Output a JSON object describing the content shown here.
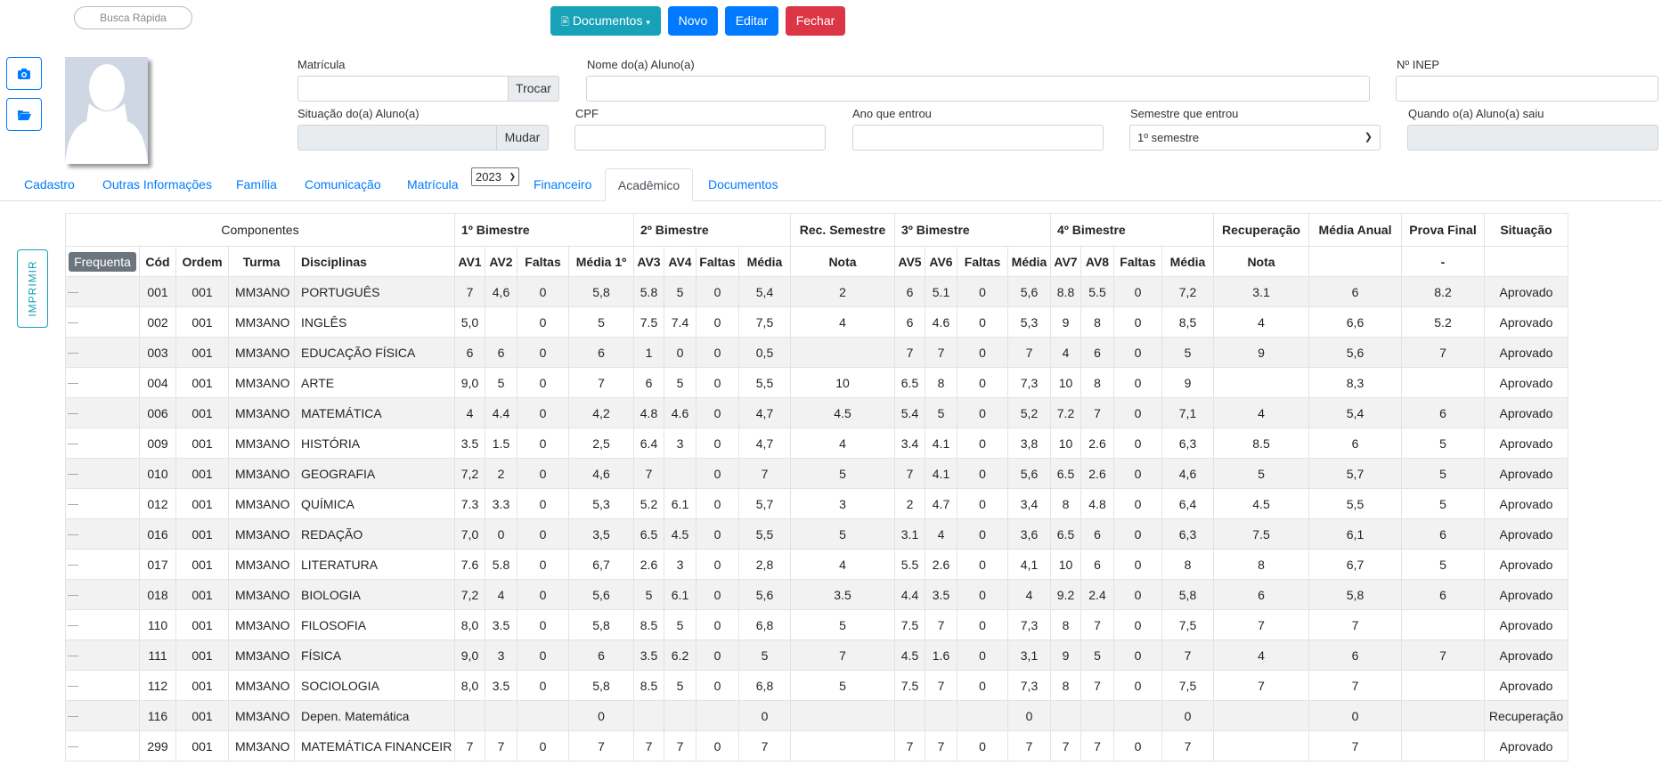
{
  "search": {
    "placeholder": "Busca Rápida"
  },
  "toolbar": {
    "documents": "Documentos",
    "new": "Novo",
    "edit": "Editar",
    "close": "Fechar"
  },
  "form": {
    "matricula_label": "Matrícula",
    "trocar": "Trocar",
    "nome_label": "Nome do(a) Aluno(a)",
    "inep_label": "Nº INEP",
    "situacao_label": "Situação do(a) Aluno(a)",
    "mudar": "Mudar",
    "cpf_label": "CPF",
    "ano_label": "Ano que entrou",
    "semestre_label": "Semestre que entrou",
    "semestre_value": "1º semestre",
    "saiu_label": "Quando o(a) Aluno(a) saiu"
  },
  "tabs": [
    "Cadastro",
    "Outras Informações",
    "Família",
    "Comunicação",
    "Matrícula",
    "Financeiro",
    "Acadêmico",
    "Documentos"
  ],
  "year_select": "2023",
  "print_button": "IMPRIMIR",
  "table": {
    "groups": [
      "Componentes",
      "1º Bimestre",
      "2º Bimestre",
      "Rec. Semestre",
      "3º Bimestre",
      "4º Bimestre",
      "Recuperação",
      "Média Anual",
      "Prova Final",
      "Situação"
    ],
    "frequenta": "Frequenta",
    "headers": [
      "Cód",
      "Ordem",
      "Turma",
      "Disciplinas",
      "AV1",
      "AV2",
      "Faltas",
      "Média 1º",
      "AV3",
      "AV4",
      "Faltas",
      "Média",
      "Nota",
      "AV5",
      "AV6",
      "Faltas",
      "Média",
      "AV7",
      "AV8",
      "Faltas",
      "Média",
      "Nota",
      "",
      "-",
      ""
    ],
    "rows": [
      [
        "001",
        "001",
        "MM3ANO",
        "PORTUGUÊS",
        "7",
        "4,6",
        "0",
        "5,8",
        "5.8",
        "5",
        "0",
        "5,4",
        "2",
        "6",
        "5.1",
        "0",
        "5,6",
        "8.8",
        "5.5",
        "0",
        "7,2",
        "3.1",
        "6",
        "8.2",
        "Aprovado"
      ],
      [
        "002",
        "001",
        "MM3ANO",
        "INGLÊS",
        "5,0",
        "",
        "0",
        "5",
        "7.5",
        "7.4",
        "0",
        "7,5",
        "4",
        "6",
        "4.6",
        "0",
        "5,3",
        "9",
        "8",
        "0",
        "8,5",
        "4",
        "6,6",
        "5.2",
        "Aprovado"
      ],
      [
        "003",
        "001",
        "MM3ANO",
        "EDUCAÇÃO FÍSICA",
        "6",
        "6",
        "0",
        "6",
        "1",
        "0",
        "0",
        "0,5",
        "",
        "7",
        "7",
        "0",
        "7",
        "4",
        "6",
        "0",
        "5",
        "9",
        "5,6",
        "7",
        "Aprovado"
      ],
      [
        "004",
        "001",
        "MM3ANO",
        "ARTE",
        "9,0",
        "5",
        "0",
        "7",
        "6",
        "5",
        "0",
        "5,5",
        "10",
        "6.5",
        "8",
        "0",
        "7,3",
        "10",
        "8",
        "0",
        "9",
        "",
        "8,3",
        "",
        "Aprovado"
      ],
      [
        "006",
        "001",
        "MM3ANO",
        "MATEMÁTICA",
        "4",
        "4.4",
        "0",
        "4,2",
        "4.8",
        "4.6",
        "0",
        "4,7",
        "4.5",
        "5.4",
        "5",
        "0",
        "5,2",
        "7.2",
        "7",
        "0",
        "7,1",
        "4",
        "5,4",
        "6",
        "Aprovado"
      ],
      [
        "009",
        "001",
        "MM3ANO",
        "HISTÓRIA",
        "3.5",
        "1.5",
        "0",
        "2,5",
        "6.4",
        "3",
        "0",
        "4,7",
        "4",
        "3.4",
        "4.1",
        "0",
        "3,8",
        "10",
        "2.6",
        "0",
        "6,3",
        "8.5",
        "6",
        "5",
        "Aprovado"
      ],
      [
        "010",
        "001",
        "MM3ANO",
        "GEOGRAFIA",
        "7,2",
        "2",
        "0",
        "4,6",
        "7",
        "",
        "0",
        "7",
        "5",
        "7",
        "4.1",
        "0",
        "5,6",
        "6.5",
        "2.6",
        "0",
        "4,6",
        "5",
        "5,7",
        "5",
        "Aprovado"
      ],
      [
        "012",
        "001",
        "MM3ANO",
        "QUÍMICA",
        "7.3",
        "3.3",
        "0",
        "5,3",
        "5.2",
        "6.1",
        "0",
        "5,7",
        "3",
        "2",
        "4.7",
        "0",
        "3,4",
        "8",
        "4.8",
        "0",
        "6,4",
        "4.5",
        "5,5",
        "5",
        "Aprovado"
      ],
      [
        "016",
        "001",
        "MM3ANO",
        "REDAÇÃO",
        "7,0",
        "0",
        "0",
        "3,5",
        "6.5",
        "4.5",
        "0",
        "5,5",
        "5",
        "3.1",
        "4",
        "0",
        "3,6",
        "6.5",
        "6",
        "0",
        "6,3",
        "7.5",
        "6,1",
        "6",
        "Aprovado"
      ],
      [
        "017",
        "001",
        "MM3ANO",
        "LITERATURA",
        "7.6",
        "5.8",
        "0",
        "6,7",
        "2.6",
        "3",
        "0",
        "2,8",
        "4",
        "5.5",
        "2.6",
        "0",
        "4,1",
        "10",
        "6",
        "0",
        "8",
        "8",
        "6,7",
        "5",
        "Aprovado"
      ],
      [
        "018",
        "001",
        "MM3ANO",
        "BIOLOGIA",
        "7,2",
        "4",
        "0",
        "5,6",
        "5",
        "6.1",
        "0",
        "5,6",
        "3.5",
        "4.4",
        "3.5",
        "0",
        "4",
        "9.2",
        "2.4",
        "0",
        "5,8",
        "6",
        "5,8",
        "6",
        "Aprovado"
      ],
      [
        "110",
        "001",
        "MM3ANO",
        "FILOSOFIA",
        "8,0",
        "3.5",
        "0",
        "5,8",
        "8.5",
        "5",
        "0",
        "6,8",
        "5",
        "7.5",
        "7",
        "0",
        "7,3",
        "8",
        "7",
        "0",
        "7,5",
        "7",
        "7",
        "",
        "Aprovado"
      ],
      [
        "111",
        "001",
        "MM3ANO",
        "FÍSICA",
        "9,0",
        "3",
        "0",
        "6",
        "3.5",
        "6.2",
        "0",
        "5",
        "7",
        "4.5",
        "1.6",
        "0",
        "3,1",
        "9",
        "5",
        "0",
        "7",
        "4",
        "6",
        "7",
        "Aprovado"
      ],
      [
        "112",
        "001",
        "MM3ANO",
        "SOCIOLOGIA",
        "8,0",
        "3.5",
        "0",
        "5,8",
        "8.5",
        "5",
        "0",
        "6,8",
        "5",
        "7.5",
        "7",
        "0",
        "7,3",
        "8",
        "7",
        "0",
        "7,5",
        "7",
        "7",
        "",
        "Aprovado"
      ],
      [
        "116",
        "001",
        "MM3ANO",
        "Depen. Matemática",
        "",
        "",
        "",
        "0",
        "",
        "",
        "",
        "0",
        "",
        "",
        "",
        "",
        "0",
        "",
        "",
        "",
        "0",
        "",
        "0",
        "",
        "Recuperação"
      ],
      [
        "299",
        "001",
        "MM3ANO",
        "MATEMÁTICA FINANCEIR",
        "7",
        "7",
        "0",
        "7",
        "7",
        "7",
        "0",
        "7",
        "",
        "7",
        "7",
        "0",
        "7",
        "7",
        "7",
        "0",
        "7",
        "",
        "7",
        "",
        "Aprovado"
      ]
    ]
  }
}
